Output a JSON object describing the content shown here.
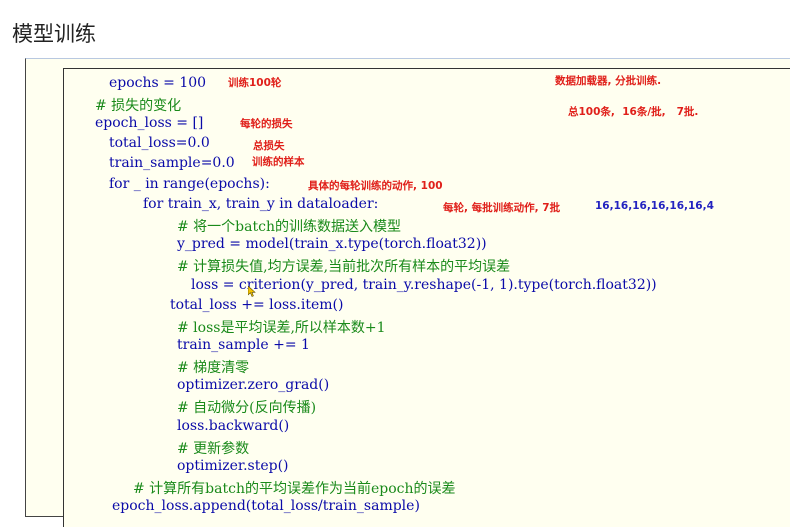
{
  "page_title": "模型训练",
  "code_lines": [
    "epochs = 100",
    "# 损失的变化",
    "epoch_loss = []",
    "total_loss=0.0",
    "train_sample=0.0",
    "for _ in range(epochs):",
    "for train_x, train_y in dataloader:",
    "# 将一个batch的训练数据送入模型",
    "y_pred = model(train_x.type(torch.float32))",
    "# 计算损失值,均方误差,当前批次所有样本的平均误差",
    "loss = criterion(y_pred, train_y.reshape(-1, 1).type(torch.float32))",
    "total_loss += loss.item()",
    "# loss是平均误差,所以样本数+1",
    "train_sample += 1",
    "# 梯度清零",
    "optimizer.zero_grad()",
    "# 自动微分(反向传播)",
    "loss.backward()",
    "# 更新参数",
    "optimizer.step()",
    "# 计算所有batch的平均误差作为当前epoch的误差",
    "epoch_loss.append(total_loss/train_sample)"
  ],
  "annotations": {
    "epochs_note": "训练100轮",
    "dataloader_note": "数据加载器, 分批训练.",
    "batches_note": "总100条,  16条/批,   7批.",
    "epoch_loss_note": "每轮的损失",
    "total_loss_note": "总损失",
    "train_sample_note": "训练的样本",
    "outer_loop_note": "具体的每轮训练的动作, 100",
    "inner_loop_note": "每轮, 每批训练动作, 7批",
    "batch_sizes_note": "16,16,16,16,16,16,4"
  },
  "colors": {
    "code": "#0a0aa8",
    "comment": "#1a8a1a",
    "annotation": "#e0201a",
    "annotation_alt": "#2323c0"
  }
}
